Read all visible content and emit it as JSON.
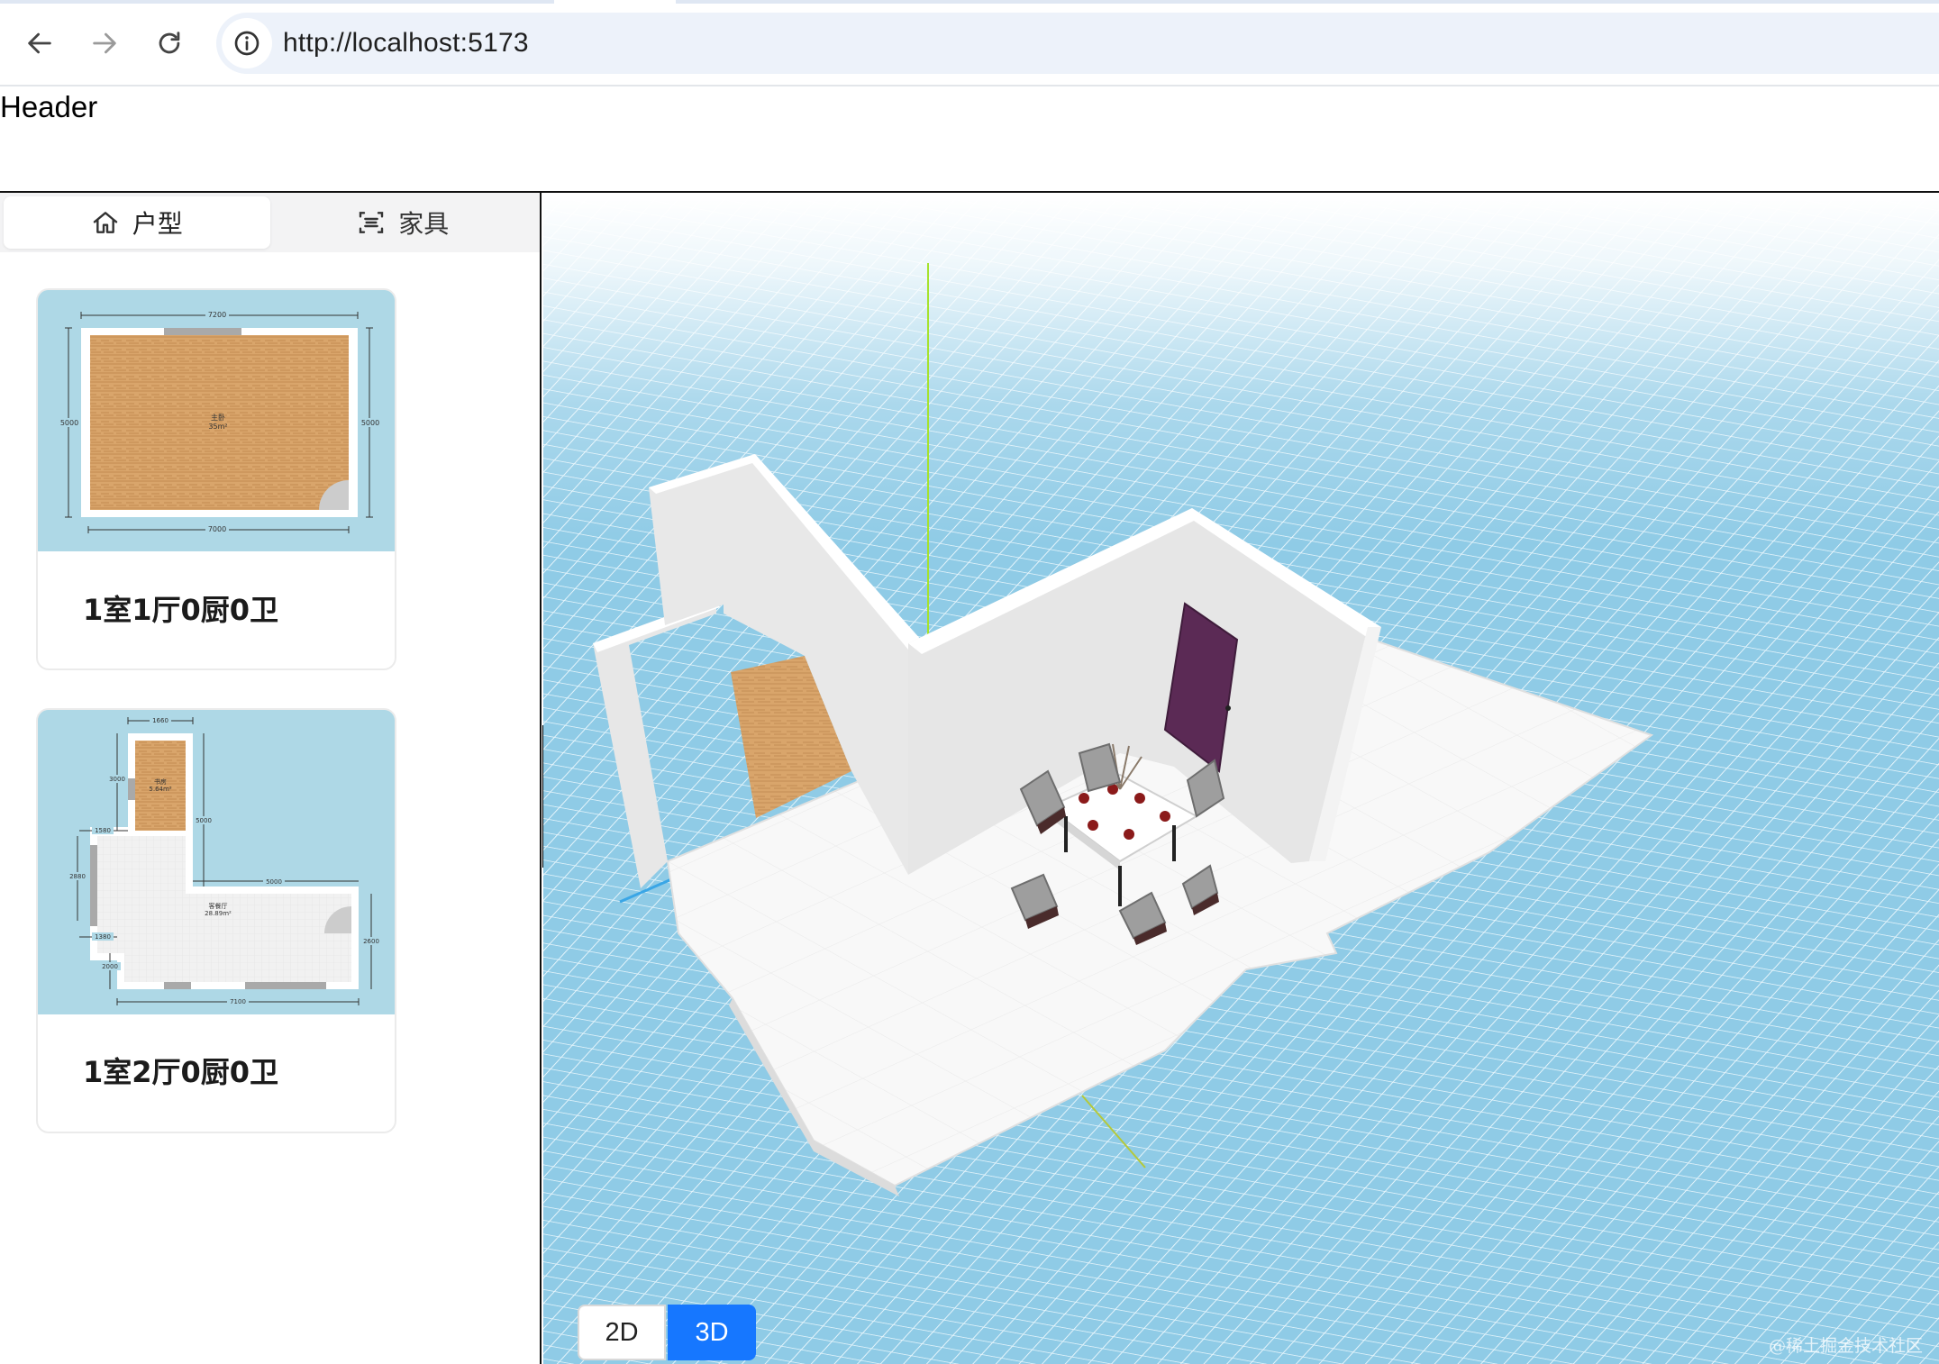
{
  "browser": {
    "url": "http://localhost:5173",
    "back_icon": "arrow-left-icon",
    "forward_icon": "arrow-right-icon",
    "reload_icon": "reload-icon",
    "site_info_icon": "info-circle-icon"
  },
  "header": {
    "title": "Header"
  },
  "sidebar": {
    "tabs": [
      {
        "label": "户型",
        "icon": "home-icon",
        "active": true
      },
      {
        "label": "家具",
        "icon": "scan-icon",
        "active": false
      }
    ],
    "floorplans": [
      {
        "title": "1室1厅0厨0卫",
        "room_label": "主卧",
        "room_area": "35m²",
        "dims": {
          "top": "7200",
          "bottom": "7000",
          "left": "5000",
          "right": "5000"
        }
      },
      {
        "title": "1室2厅0厨0卫",
        "room_labels": [
          "书房",
          "客餐厅"
        ],
        "room_areas": [
          "5.64m²",
          "28.89m²"
        ],
        "dims": [
          "1660",
          "3000",
          "1580",
          "5000",
          "2880",
          "5000",
          "1380",
          "2000",
          "7100",
          "2600"
        ]
      }
    ]
  },
  "viewer": {
    "modes": [
      {
        "label": "2D",
        "active": false
      },
      {
        "label": "3D",
        "active": true
      }
    ],
    "colors": {
      "grid_bg": "#8fcbe6",
      "grid_line": "#e8f6fc",
      "wall": "#e6e6e6",
      "wall_top": "#ffffff",
      "floor_tile": "#f7f7f7",
      "wood": "#d9a56b",
      "door": "#5b2a55",
      "chair": "#a9a9a9",
      "axis_y": "#a6e22e",
      "axis_x": "#3aa6e6"
    }
  },
  "watermark": "@稀土掘金技术社区"
}
